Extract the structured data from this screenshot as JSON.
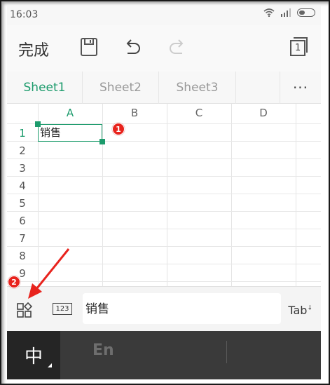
{
  "status_bar": {
    "time": "16:03"
  },
  "toolbar": {
    "done_label": "完成",
    "page_count": "1"
  },
  "sheet_tabs": {
    "items": [
      {
        "label": "Sheet1",
        "active": true
      },
      {
        "label": "Sheet2",
        "active": false
      },
      {
        "label": "Sheet3",
        "active": false
      }
    ],
    "more_label": "···"
  },
  "grid": {
    "columns": [
      "A",
      "B",
      "C",
      "D"
    ],
    "rows": [
      "1",
      "2",
      "3",
      "4",
      "5",
      "6",
      "7",
      "8",
      "9"
    ],
    "active_cell": "A1",
    "cells": {
      "A1": "销售"
    }
  },
  "annotations": {
    "badge_1": "1",
    "badge_2": "2",
    "arrow_color": "#e8231d"
  },
  "input_bar": {
    "format_key_label": "123",
    "value": "销售",
    "tab_label": "Tab"
  },
  "keyboard": {
    "chinese_label": "中",
    "english_label": "En"
  },
  "colors": {
    "accent": "#1c9b6c",
    "annotation_red": "#e8231d"
  }
}
